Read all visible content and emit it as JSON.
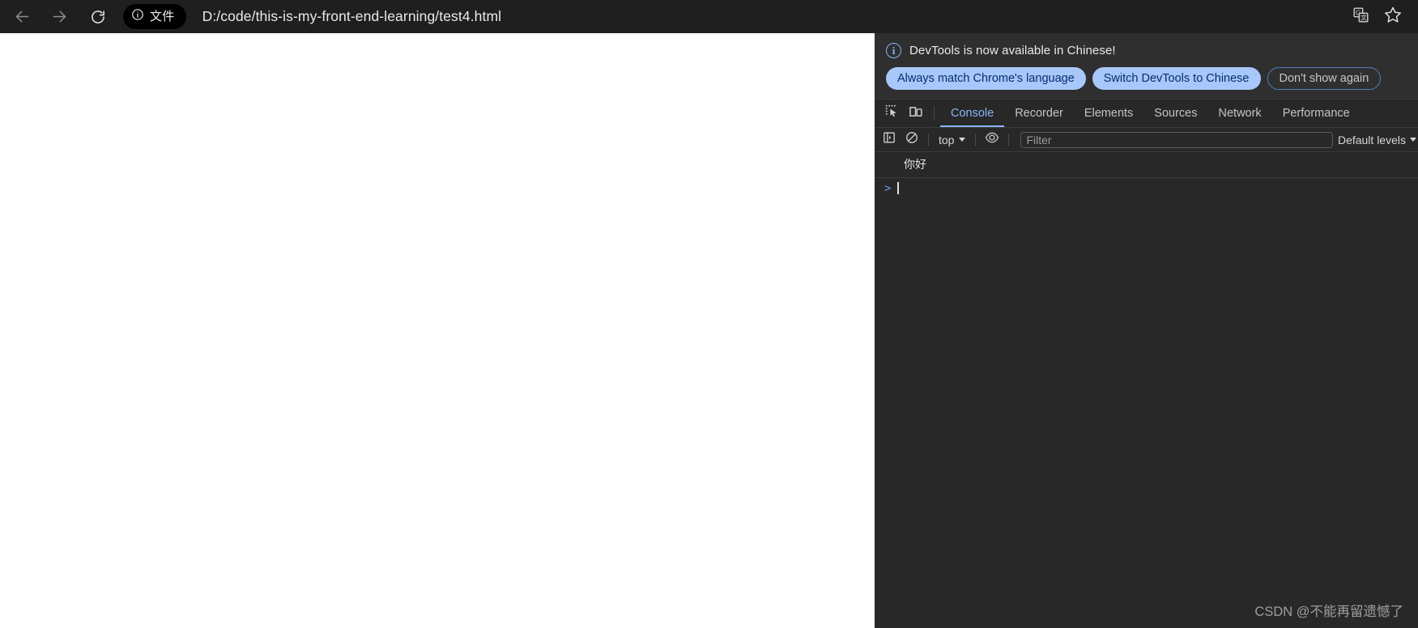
{
  "browser": {
    "back_icon": "arrow-left-icon",
    "forward_icon": "arrow-right-icon",
    "reload_icon": "reload-icon",
    "file_chip_label": "文件",
    "file_chip_icon": "info-circle-icon",
    "url": "D:/code/this-is-my-front-end-learning/test4.html",
    "translate_icon": "google-translate-icon",
    "bookmark_icon": "star-icon",
    "chrome_bg": "#1f1f1f",
    "text_color": "#e8eaed"
  },
  "devtools": {
    "banner": {
      "icon": "info-circle-icon",
      "message": "DevTools is now available in Chinese!",
      "buttons": [
        {
          "label": "Always match Chrome's language",
          "style": "primary"
        },
        {
          "label": "Switch DevTools to Chinese",
          "style": "primary"
        },
        {
          "label": "Don't show again",
          "style": "outline"
        }
      ],
      "primary_bg": "#a8c7fa",
      "primary_fg": "#062e6f",
      "outline_border": "#4f7fbf"
    },
    "tabs": {
      "inspect_icon": "inspect-element-icon",
      "device_icon": "device-toolbar-icon",
      "items": [
        {
          "label": "Console",
          "active": true
        },
        {
          "label": "Recorder",
          "active": false
        },
        {
          "label": "Elements",
          "active": false
        },
        {
          "label": "Sources",
          "active": false
        },
        {
          "label": "Network",
          "active": false
        },
        {
          "label": "Performance",
          "active": false
        }
      ],
      "active_color": "#8ab4f8",
      "inactive_color": "#c4c4c4"
    },
    "console_toolbar": {
      "sidebar_icon": "console-sidebar-icon",
      "clear_icon": "clear-console-icon",
      "context": "top",
      "eye_icon": "live-expression-eye-icon",
      "filter_placeholder": "Filter",
      "filter_value": "",
      "levels": "Default levels"
    },
    "console": {
      "messages": [
        {
          "text": "你好"
        }
      ],
      "prompt_arrow": ">",
      "prompt_value": ""
    },
    "panel_bg": "#282828",
    "banner_bg": "#2f2f2f"
  },
  "watermark": {
    "text": "CSDN @不能再留遗憾了"
  }
}
